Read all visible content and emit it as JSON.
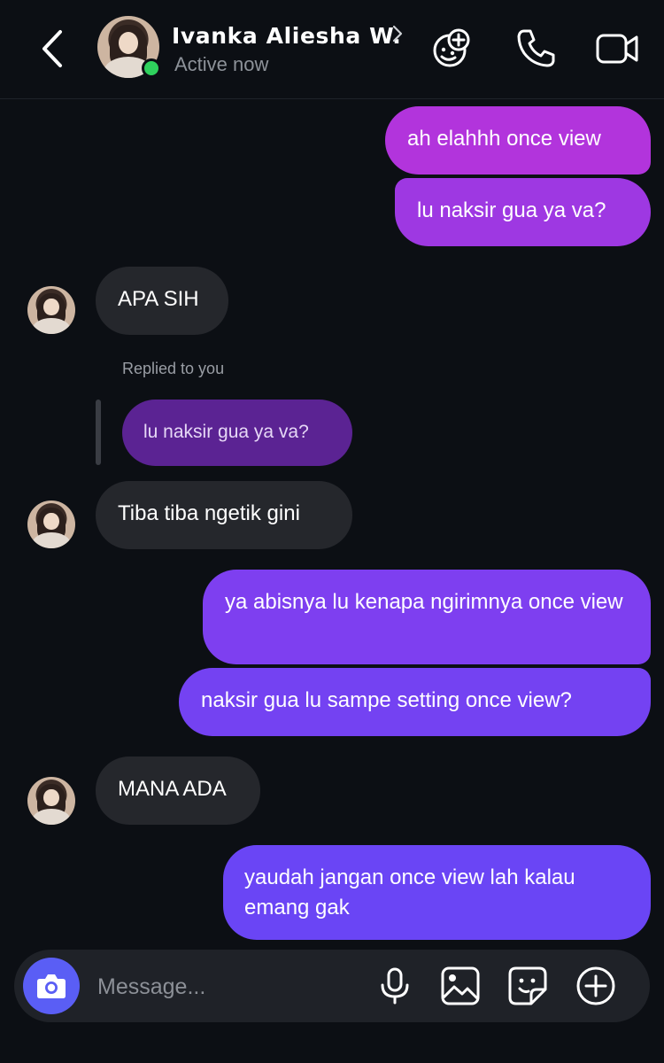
{
  "header": {
    "contact_name": "Ivanka Aliesha W.",
    "status": "Active now",
    "icons": [
      "back-icon",
      "chevron-right-icon",
      "gamepad-icon",
      "phone-icon",
      "video-icon"
    ]
  },
  "messages": [
    {
      "from": "me",
      "text": "ah elahhh once view"
    },
    {
      "from": "me",
      "text": "lu naksir gua ya va?"
    },
    {
      "from": "them",
      "text": "APA SIH"
    },
    {
      "from": "them",
      "reply_label": "Replied to you",
      "quoted": "lu naksir gua ya va?"
    },
    {
      "from": "them",
      "text": "Tiba tiba ngetik gini"
    },
    {
      "from": "me",
      "text": "ya abisnya lu kenapa ngirimnya once view"
    },
    {
      "from": "me",
      "text": "naksir gua lu sampe setting once view?"
    },
    {
      "from": "them",
      "text": "MANA ADA"
    },
    {
      "from": "me",
      "text": "yaudah jangan once view lah kalau emang gak"
    }
  ],
  "composer": {
    "placeholder": "Message...",
    "icons": [
      "camera-icon",
      "microphone-icon",
      "gallery-icon",
      "sticker-icon",
      "add-icon"
    ]
  },
  "colors": {
    "background": "#0c0f14",
    "incoming_bubble": "#25272c",
    "outgoing_gradient_top": "#b234dc",
    "outgoing_gradient_bottom": "#6a45f5",
    "reply_bubble": "#5b2393",
    "online": "#2fd15d",
    "camera_button": "#5a5ef5"
  }
}
